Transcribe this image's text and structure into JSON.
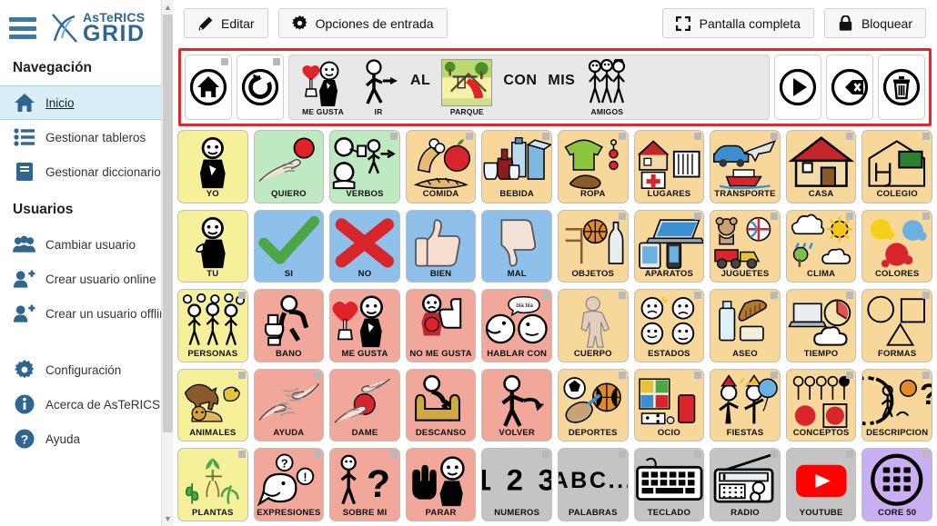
{
  "app": {
    "logo_top": "AsTeRICS",
    "logo_bottom": "GRID",
    "hamburger": "menu-icon"
  },
  "sidebar": {
    "section_nav": "Navegación",
    "section_users": "Usuarios",
    "nav_items": [
      {
        "label": "Inicio",
        "icon": "home-icon",
        "active": true
      },
      {
        "label": "Gestionar tableros",
        "icon": "list-icon",
        "active": false
      },
      {
        "label": "Gestionar diccionarios",
        "icon": "book-icon",
        "active": false
      }
    ],
    "user_items": [
      {
        "label": "Cambiar usuario",
        "icon": "users-icon"
      },
      {
        "label": "Crear usuario online",
        "icon": "user-plus-icon"
      },
      {
        "label": "Crear un usuario offline",
        "icon": "user-plus-icon"
      }
    ],
    "bottom_items": [
      {
        "label": "Configuración",
        "icon": "gear-icon"
      },
      {
        "label": "Acerca de AsTeRICS Grid",
        "icon": "info-icon"
      },
      {
        "label": "Ayuda",
        "icon": "question-icon"
      }
    ]
  },
  "toolbar": {
    "edit_label": "Editar",
    "input_options_label": "Opciones de entrada",
    "fullscreen_label": "Pantalla completa",
    "lock_label": "Bloquear",
    "edit_icon": "pencil-icon",
    "input_options_icon": "gear-icon",
    "fullscreen_icon": "expand-icon",
    "lock_icon": "lock-icon"
  },
  "collect": {
    "frame_color": "#e8232a",
    "left_controls": [
      {
        "name": "home-button",
        "icon": "home-circle-icon"
      },
      {
        "name": "undo-button",
        "icon": "undo-circle-icon"
      }
    ],
    "words": [
      {
        "label": "ME GUSTA",
        "type": "pictogram",
        "art": "like-heart"
      },
      {
        "label": "IR",
        "type": "pictogram",
        "art": "walk"
      },
      {
        "label": "AL",
        "type": "text"
      },
      {
        "label": "PARQUE",
        "type": "pictogram",
        "art": "park"
      },
      {
        "label": "CON",
        "type": "text"
      },
      {
        "label": "MIS",
        "type": "text"
      },
      {
        "label": "AMIGOS",
        "type": "pictogram",
        "art": "friends"
      }
    ],
    "right_controls": [
      {
        "name": "speak-button",
        "icon": "play-circle-icon"
      },
      {
        "name": "backspace-button",
        "icon": "backspace-icon"
      },
      {
        "name": "clear-button",
        "icon": "trash-icon"
      }
    ]
  },
  "grid": {
    "columns": 10,
    "rows": 5,
    "colors": {
      "yellow": "#f6f09a",
      "green": "#bfe9c0",
      "orange": "#f7d89a",
      "blue": "#8ec0ea",
      "salmon": "#f2a79b",
      "gray": "#c4c4c4",
      "purple": "#c9aef2"
    },
    "cells": [
      {
        "label": "YO",
        "color": "yellow",
        "art": "person-self",
        "corner": false
      },
      {
        "label": "QUIERO",
        "color": "green",
        "art": "want-hand-ball",
        "corner": false
      },
      {
        "label": "VERBOS",
        "color": "green",
        "art": "verbs",
        "corner": true
      },
      {
        "label": "COMIDA",
        "color": "orange",
        "art": "food",
        "corner": true
      },
      {
        "label": "BEBIDA",
        "color": "orange",
        "art": "drink",
        "corner": true
      },
      {
        "label": "ROPA",
        "color": "orange",
        "art": "clothes",
        "corner": true
      },
      {
        "label": "LUGARES",
        "color": "orange",
        "art": "places",
        "corner": true
      },
      {
        "label": "TRANSPORTE",
        "color": "orange",
        "art": "transport",
        "corner": true
      },
      {
        "label": "CASA",
        "color": "orange",
        "art": "house",
        "corner": true
      },
      {
        "label": "COLEGIO",
        "color": "orange",
        "art": "school",
        "corner": true
      },
      {
        "label": "TÚ",
        "color": "yellow",
        "art": "person-you",
        "corner": false
      },
      {
        "label": "SÍ",
        "color": "blue",
        "art": "check",
        "corner": false
      },
      {
        "label": "NO",
        "color": "blue",
        "art": "cross",
        "corner": false
      },
      {
        "label": "BIEN",
        "color": "blue",
        "art": "thumbs-up",
        "corner": false
      },
      {
        "label": "MAL",
        "color": "blue",
        "art": "thumbs-down",
        "corner": false
      },
      {
        "label": "OBJETOS",
        "color": "orange",
        "art": "objects",
        "corner": true
      },
      {
        "label": "APARATOS",
        "color": "orange",
        "art": "devices",
        "corner": true
      },
      {
        "label": "JUGUETES",
        "color": "orange",
        "art": "toys",
        "corner": true
      },
      {
        "label": "CLIMA",
        "color": "orange",
        "art": "weather",
        "corner": true
      },
      {
        "label": "COLORES",
        "color": "orange",
        "art": "colors",
        "corner": true
      },
      {
        "label": "PERSONAS",
        "color": "yellow",
        "art": "people",
        "corner": true
      },
      {
        "label": "BAÑO",
        "color": "salmon",
        "art": "toilet",
        "corner": false
      },
      {
        "label": "ME GUSTA",
        "color": "salmon",
        "art": "like-heart",
        "corner": false
      },
      {
        "label": "NO ME GUSTA",
        "color": "salmon",
        "art": "dislike",
        "corner": false
      },
      {
        "label": "HABLAR CON",
        "color": "salmon",
        "art": "talk",
        "corner": true
      },
      {
        "label": "CUERPO",
        "color": "orange",
        "art": "body",
        "corner": true
      },
      {
        "label": "ESTADOS",
        "color": "orange",
        "art": "states",
        "corner": true
      },
      {
        "label": "ASEO",
        "color": "orange",
        "art": "hygiene",
        "corner": true
      },
      {
        "label": "TIEMPO",
        "color": "orange",
        "art": "time",
        "corner": true
      },
      {
        "label": "FORMAS",
        "color": "orange",
        "art": "shapes",
        "corner": true
      },
      {
        "label": "ANIMALES",
        "color": "yellow",
        "art": "animals",
        "corner": true
      },
      {
        "label": "AYUDA",
        "color": "salmon",
        "art": "help-hands",
        "corner": true
      },
      {
        "label": "DAME",
        "color": "salmon",
        "art": "give-me",
        "corner": false
      },
      {
        "label": "DESCANSO",
        "color": "salmon",
        "art": "rest",
        "corner": false
      },
      {
        "label": "VOLVER",
        "color": "salmon",
        "art": "return",
        "corner": false
      },
      {
        "label": "DEPORTES",
        "color": "orange",
        "art": "sports",
        "corner": true
      },
      {
        "label": "OCIO",
        "color": "orange",
        "art": "leisure",
        "corner": true
      },
      {
        "label": "FIESTAS",
        "color": "orange",
        "art": "party",
        "corner": true
      },
      {
        "label": "CONCEPTOS",
        "color": "orange",
        "art": "concepts",
        "corner": true
      },
      {
        "label": "DESCRIPCIÓN",
        "color": "orange",
        "art": "description",
        "corner": true
      },
      {
        "label": "PLANTAS",
        "color": "yellow",
        "art": "plants",
        "corner": true
      },
      {
        "label": "EXPRESIONES",
        "color": "salmon",
        "art": "expressions",
        "corner": true
      },
      {
        "label": "SOBRE MÍ",
        "color": "salmon",
        "art": "about-me",
        "corner": true
      },
      {
        "label": "PARAR",
        "color": "salmon",
        "art": "stop",
        "corner": false
      },
      {
        "label": "NÚMEROS",
        "color": "gray",
        "art": "numbers",
        "corner": true
      },
      {
        "label": "PALABRAS",
        "color": "gray",
        "art": "words-abc",
        "corner": true
      },
      {
        "label": "TECLADO",
        "color": "gray",
        "art": "keyboard",
        "corner": true
      },
      {
        "label": "RADIO",
        "color": "gray",
        "art": "radio",
        "corner": true
      },
      {
        "label": "YOUTUBE",
        "color": "gray",
        "art": "youtube",
        "corner": true
      },
      {
        "label": "CORE 50",
        "color": "purple",
        "art": "core50",
        "corner": true
      }
    ]
  }
}
